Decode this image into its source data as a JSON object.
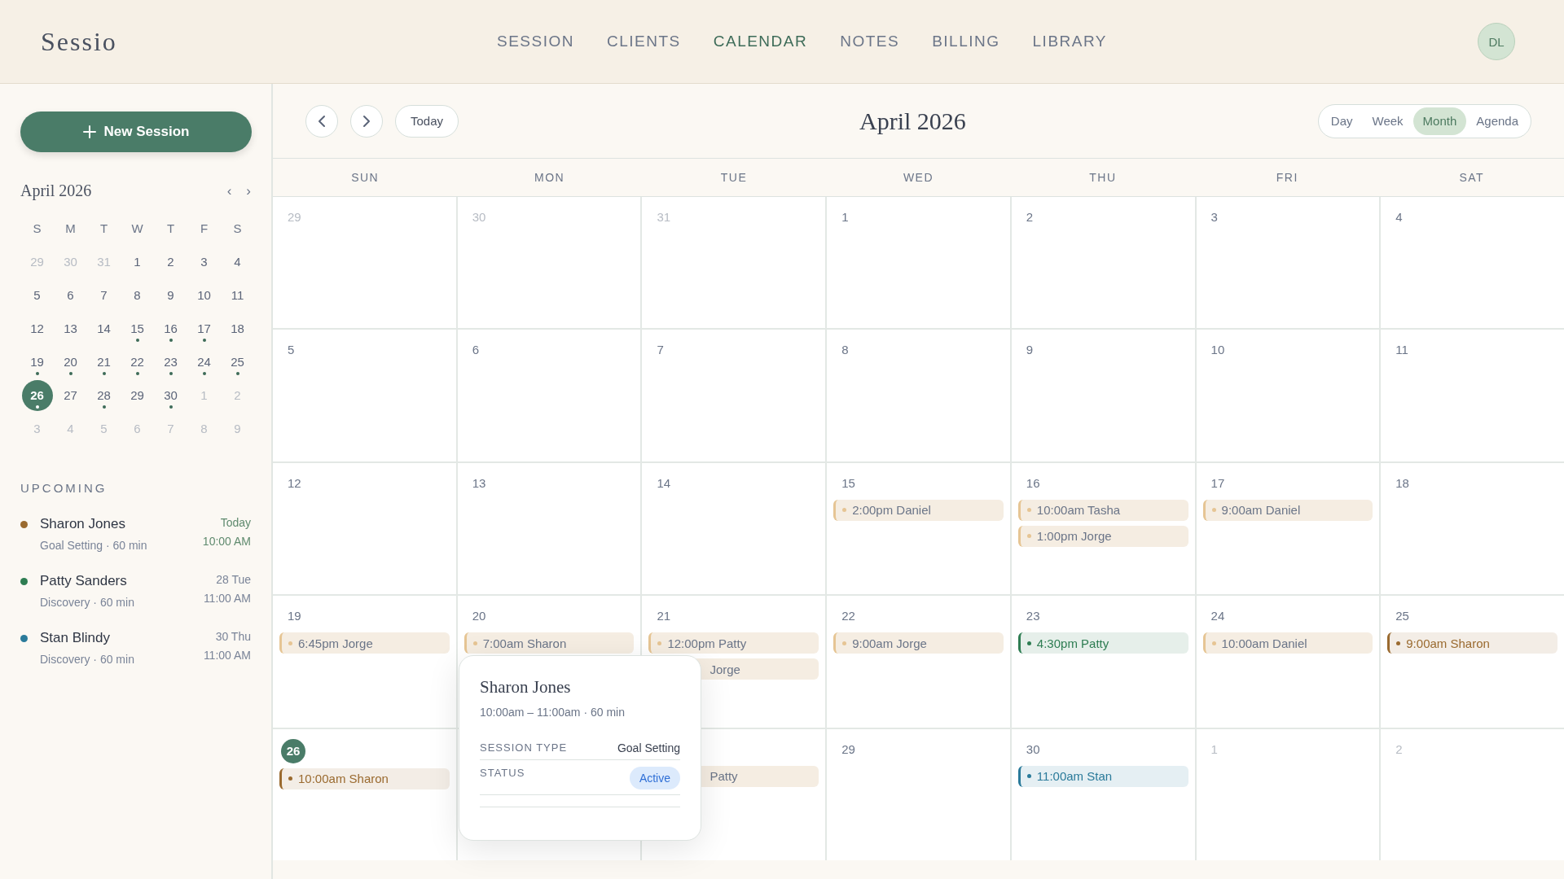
{
  "brand": "Sessio",
  "nav": [
    {
      "label": "SESSION",
      "selected": false
    },
    {
      "label": "CLIENTS",
      "selected": false
    },
    {
      "label": "CALENDAR",
      "selected": true
    },
    {
      "label": "NOTES",
      "selected": false
    },
    {
      "label": "BILLING",
      "selected": false
    },
    {
      "label": "LIBRARY",
      "selected": false
    }
  ],
  "avatar": "DL",
  "sidebar": {
    "new_button": "New Session",
    "mini_calendar": {
      "title": "April 2026",
      "prev": "‹",
      "next": "›",
      "weekdays": [
        "S",
        "M",
        "T",
        "W",
        "T",
        "F",
        "S"
      ],
      "days": [
        {
          "label": "29",
          "muted": true,
          "dot": false,
          "selected": false
        },
        {
          "label": "30",
          "muted": true,
          "dot": false,
          "selected": false
        },
        {
          "label": "31",
          "muted": true,
          "dot": false,
          "selected": false
        },
        {
          "label": "1",
          "muted": false,
          "dot": false,
          "selected": false
        },
        {
          "label": "2",
          "muted": false,
          "dot": false,
          "selected": false
        },
        {
          "label": "3",
          "muted": false,
          "dot": false,
          "selected": false
        },
        {
          "label": "4",
          "muted": false,
          "dot": false,
          "selected": false
        },
        {
          "label": "5",
          "muted": false,
          "dot": false,
          "selected": false
        },
        {
          "label": "6",
          "muted": false,
          "dot": false,
          "selected": false
        },
        {
          "label": "7",
          "muted": false,
          "dot": false,
          "selected": false
        },
        {
          "label": "8",
          "muted": false,
          "dot": false,
          "selected": false
        },
        {
          "label": "9",
          "muted": false,
          "dot": false,
          "selected": false
        },
        {
          "label": "10",
          "muted": false,
          "dot": false,
          "selected": false
        },
        {
          "label": "11",
          "muted": false,
          "dot": false,
          "selected": false
        },
        {
          "label": "12",
          "muted": false,
          "dot": false,
          "selected": false
        },
        {
          "label": "13",
          "muted": false,
          "dot": false,
          "selected": false
        },
        {
          "label": "14",
          "muted": false,
          "dot": false,
          "selected": false
        },
        {
          "label": "15",
          "muted": false,
          "dot": true,
          "selected": false
        },
        {
          "label": "16",
          "muted": false,
          "dot": true,
          "selected": false
        },
        {
          "label": "17",
          "muted": false,
          "dot": true,
          "selected": false
        },
        {
          "label": "18",
          "muted": false,
          "dot": false,
          "selected": false
        },
        {
          "label": "19",
          "muted": false,
          "dot": true,
          "selected": false
        },
        {
          "label": "20",
          "muted": false,
          "dot": true,
          "selected": false
        },
        {
          "label": "21",
          "muted": false,
          "dot": true,
          "selected": false
        },
        {
          "label": "22",
          "muted": false,
          "dot": true,
          "selected": false
        },
        {
          "label": "23",
          "muted": false,
          "dot": true,
          "selected": false
        },
        {
          "label": "24",
          "muted": false,
          "dot": true,
          "selected": false
        },
        {
          "label": "25",
          "muted": false,
          "dot": true,
          "selected": false
        },
        {
          "label": "26",
          "muted": false,
          "dot": true,
          "selected": true
        },
        {
          "label": "27",
          "muted": false,
          "dot": false,
          "selected": false
        },
        {
          "label": "28",
          "muted": false,
          "dot": true,
          "selected": false
        },
        {
          "label": "29",
          "muted": false,
          "dot": false,
          "selected": false
        },
        {
          "label": "30",
          "muted": false,
          "dot": true,
          "selected": false
        },
        {
          "label": "1",
          "muted": true,
          "dot": false,
          "selected": false
        },
        {
          "label": "2",
          "muted": true,
          "dot": false,
          "selected": false
        },
        {
          "label": "3",
          "muted": true,
          "dot": false,
          "selected": false
        },
        {
          "label": "4",
          "muted": true,
          "dot": false,
          "selected": false
        },
        {
          "label": "5",
          "muted": true,
          "dot": false,
          "selected": false
        },
        {
          "label": "6",
          "muted": true,
          "dot": false,
          "selected": false
        },
        {
          "label": "7",
          "muted": true,
          "dot": false,
          "selected": false
        },
        {
          "label": "8",
          "muted": true,
          "dot": false,
          "selected": false
        },
        {
          "label": "9",
          "muted": true,
          "dot": false,
          "selected": false
        }
      ]
    },
    "upcoming_title": "UPCOMING",
    "upcoming": [
      {
        "name": "Sharon Jones",
        "detail": "Goal Setting · 60 min",
        "date": "Today",
        "time": "10:00 AM",
        "color": "#9a6a2f",
        "today": true
      },
      {
        "name": "Patty Sanders",
        "detail": "Discovery · 60 min",
        "date": "28 Tue",
        "time": "11:00 AM",
        "color": "#2e7d52",
        "today": false
      },
      {
        "name": "Stan Blindy",
        "detail": "Discovery · 60 min",
        "date": "30 Thu",
        "time": "11:00 AM",
        "color": "#2a7a9a",
        "today": false
      }
    ]
  },
  "toolbar": {
    "today": "Today",
    "title": "April 2026",
    "views": [
      {
        "label": "Day",
        "selected": false
      },
      {
        "label": "Week",
        "selected": false
      },
      {
        "label": "Month",
        "selected": true
      },
      {
        "label": "Agenda",
        "selected": false
      }
    ]
  },
  "weekdays": [
    "SUN",
    "MON",
    "TUE",
    "WED",
    "THU",
    "FRI",
    "SAT"
  ],
  "cells": [
    {
      "day": "29",
      "muted": true,
      "today": false
    },
    {
      "day": "30",
      "muted": true,
      "today": false
    },
    {
      "day": "31",
      "muted": true,
      "today": false
    },
    {
      "day": "1",
      "muted": false,
      "today": false
    },
    {
      "day": "2",
      "muted": false,
      "today": false
    },
    {
      "day": "3",
      "muted": false,
      "today": false
    },
    {
      "day": "4",
      "muted": false,
      "today": false
    },
    {
      "day": "5",
      "muted": false,
      "today": false
    },
    {
      "day": "6",
      "muted": false,
      "today": false
    },
    {
      "day": "7",
      "muted": false,
      "today": false
    },
    {
      "day": "8",
      "muted": false,
      "today": false
    },
    {
      "day": "9",
      "muted": false,
      "today": false
    },
    {
      "day": "10",
      "muted": false,
      "today": false
    },
    {
      "day": "11",
      "muted": false,
      "today": false
    },
    {
      "day": "12",
      "muted": false,
      "today": false
    },
    {
      "day": "13",
      "muted": false,
      "today": false
    },
    {
      "day": "14",
      "muted": false,
      "today": false
    },
    {
      "day": "15",
      "muted": false,
      "today": false,
      "events": [
        {
          "text": "2:00pm Daniel",
          "color": "#e6c594",
          "past": true
        }
      ]
    },
    {
      "day": "16",
      "muted": false,
      "today": false,
      "events": [
        {
          "text": "10:00am Tasha",
          "color": "#e6c594",
          "past": true
        },
        {
          "text": "1:00pm Jorge",
          "color": "#e6c594",
          "past": true
        }
      ]
    },
    {
      "day": "17",
      "muted": false,
      "today": false,
      "events": [
        {
          "text": "9:00am Daniel",
          "color": "#e6c594",
          "past": true
        }
      ]
    },
    {
      "day": "18",
      "muted": false,
      "today": false
    },
    {
      "day": "19",
      "muted": false,
      "today": false,
      "events": [
        {
          "text": "6:45pm Jorge",
          "color": "#e6c594",
          "past": true
        }
      ]
    },
    {
      "day": "20",
      "muted": false,
      "today": false,
      "events": [
        {
          "text": "7:00am Sharon",
          "color": "#e6c594",
          "past": true
        }
      ]
    },
    {
      "day": "21",
      "muted": false,
      "today": false,
      "events": [
        {
          "text": "12:00pm Patty",
          "color": "#e6c594",
          "past": true
        },
        {
          "text": "Jorge",
          "past": true,
          "cut": true
        }
      ]
    },
    {
      "day": "22",
      "muted": false,
      "today": false,
      "events": [
        {
          "text": "9:00am Jorge",
          "color": "#e6c594",
          "past": true
        }
      ]
    },
    {
      "day": "23",
      "muted": false,
      "today": false,
      "events": [
        {
          "text": "4:30pm Patty",
          "color": "#2e7d52",
          "past": false
        }
      ]
    },
    {
      "day": "24",
      "muted": false,
      "today": false,
      "events": [
        {
          "text": "10:00am Daniel",
          "color": "#e6c594",
          "past": true
        }
      ]
    },
    {
      "day": "25",
      "muted": false,
      "today": false,
      "events": [
        {
          "text": "9:00am Sharon",
          "color": "#9a6a2f",
          "past": false
        }
      ]
    },
    {
      "day": "26",
      "muted": false,
      "today": true,
      "events": [
        {
          "text": "10:00am Sharon",
          "color": "#9a6a2f",
          "past": false
        }
      ]
    },
    {},
    {
      "events": [
        {
          "text": "Patty",
          "past": true,
          "cut": true
        }
      ]
    },
    {
      "day": "29",
      "muted": false,
      "today": false
    },
    {
      "day": "30",
      "muted": false,
      "today": false,
      "events": [
        {
          "text": "11:00am Stan",
          "color": "#2a7a9a",
          "past": false
        }
      ]
    },
    {
      "day": "1",
      "muted": true,
      "today": false
    },
    {
      "day": "2",
      "muted": true,
      "today": false
    }
  ],
  "popover": {
    "title": "Sharon Jones",
    "time": "10:00am – 11:00am · 60 min",
    "rows": [
      {
        "label": "SESSION TYPE",
        "value": "Goal Setting",
        "kind": "text"
      },
      {
        "label": "STATUS",
        "value": "Active",
        "kind": "badge"
      }
    ]
  }
}
